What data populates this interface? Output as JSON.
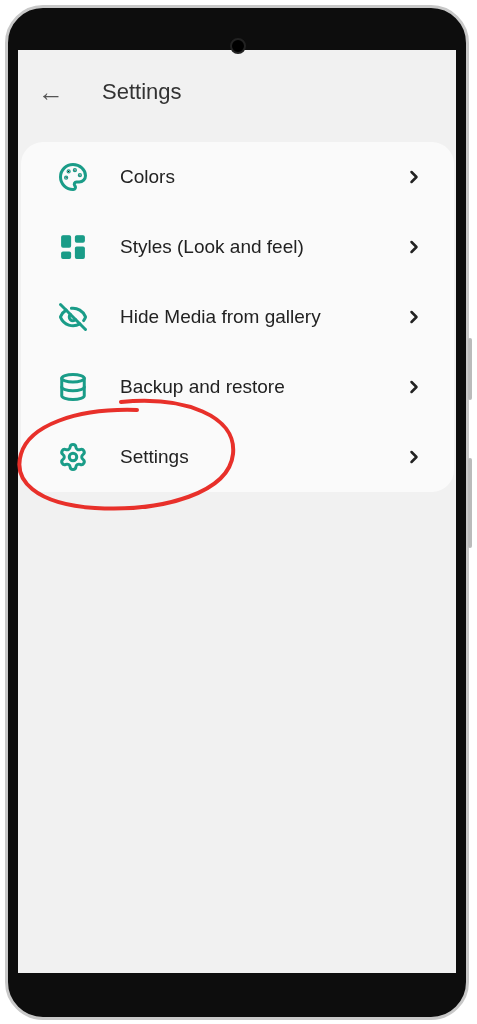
{
  "header": {
    "back": "←",
    "title": "Settings"
  },
  "items": [
    {
      "label": "Colors",
      "circled": false
    },
    {
      "label": "Styles (Look and feel)",
      "circled": false
    },
    {
      "label": "Hide Media from gallery",
      "circled": false
    },
    {
      "label": "Backup and restore",
      "circled": false
    },
    {
      "label": "Settings",
      "circled": true
    }
  ]
}
